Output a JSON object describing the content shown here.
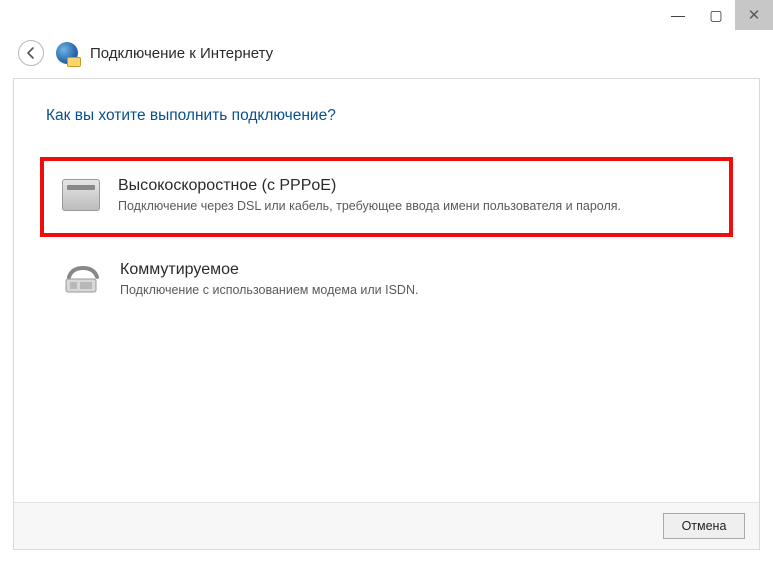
{
  "titlebar": {
    "minimize": "—",
    "maximize": "▢",
    "close": "✕"
  },
  "header": {
    "title": "Подключение к Интернету"
  },
  "content": {
    "question": "Как вы хотите выполнить подключение?",
    "options": [
      {
        "title": "Высокоскоростное (с PPPoE)",
        "description": "Подключение через DSL или кабель, требующее ввода имени пользователя и пароля."
      },
      {
        "title": "Коммутируемое",
        "description": "Подключение с использованием модема или ISDN."
      }
    ]
  },
  "footer": {
    "cancel": "Отмена"
  }
}
